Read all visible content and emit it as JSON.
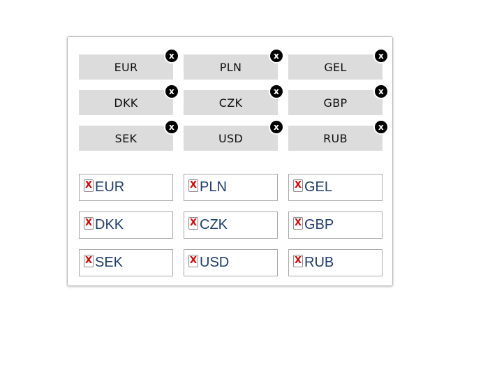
{
  "chips": [
    {
      "label": "EUR",
      "close": "x"
    },
    {
      "label": "PLN",
      "close": "x"
    },
    {
      "label": "GEL",
      "close": "x"
    },
    {
      "label": "DKK",
      "close": "x"
    },
    {
      "label": "CZK",
      "close": "x"
    },
    {
      "label": "GBP",
      "close": "x"
    },
    {
      "label": "SEK",
      "close": "x"
    },
    {
      "label": "USD",
      "close": "x"
    },
    {
      "label": "RUB",
      "close": "x"
    }
  ],
  "boxes": [
    {
      "label": "EUR",
      "remove": "X"
    },
    {
      "label": "PLN",
      "remove": "X"
    },
    {
      "label": "GEL",
      "remove": "X"
    },
    {
      "label": "DKK",
      "remove": "X"
    },
    {
      "label": "CZK",
      "remove": "X"
    },
    {
      "label": "GBP",
      "remove": "X"
    },
    {
      "label": "SEK",
      "remove": "X"
    },
    {
      "label": "USD",
      "remove": "X"
    },
    {
      "label": "RUB",
      "remove": "X"
    }
  ],
  "colors": {
    "chip_bg": "#dcdcdc",
    "close_bg": "#000000",
    "remove_x": "#e00000",
    "box_text": "#1c3d6e"
  },
  "icons": {
    "chip_close": "close-circle-icon",
    "box_remove": "remove-x-icon"
  }
}
